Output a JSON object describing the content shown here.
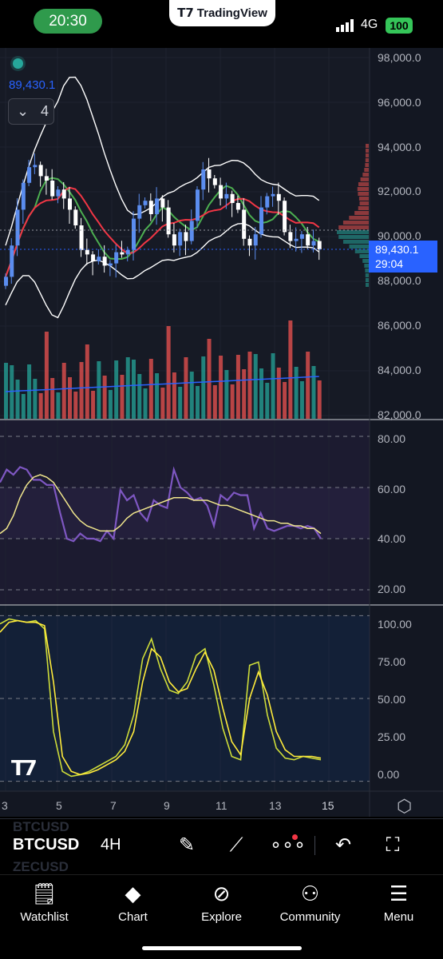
{
  "status_bar": {
    "time": "20:30",
    "app_brand": "TradingView",
    "network": "4G",
    "battery": "100"
  },
  "legend": {
    "price": "89,430.1",
    "collapse_count": "4"
  },
  "price_axis": {
    "labels": [
      "98,000.0",
      "96,000.0",
      "94,000.0",
      "92,000.0",
      "90,000.0",
      "88,000.0",
      "86,000.0",
      "84,000.0",
      "82,000.0"
    ],
    "current_price": "89,430.1",
    "countdown": "29:04"
  },
  "rsi_axis": {
    "labels": [
      "80.00",
      "60.00",
      "40.00",
      "20.00"
    ]
  },
  "stoch_axis": {
    "labels": [
      "100.00",
      "75.00",
      "50.00",
      "25.00",
      "0.00"
    ]
  },
  "time_axis": {
    "labels": [
      "3",
      "5",
      "7",
      "9",
      "11",
      "13",
      "15"
    ]
  },
  "toolbar": {
    "symbol": "BTCUSD",
    "interval": "4H",
    "ghost_symbols": [
      "BTCUSD",
      "ZECUSD"
    ]
  },
  "nav": {
    "items": [
      {
        "label": "Watchlist",
        "icon": "watchlist-icon"
      },
      {
        "label": "Chart",
        "icon": "chart-icon"
      },
      {
        "label": "Explore",
        "icon": "compass-icon"
      },
      {
        "label": "Community",
        "icon": "community-icon"
      },
      {
        "label": "Menu",
        "icon": "menu-icon"
      }
    ]
  },
  "colors": {
    "background": "#131722",
    "up": "#5b8def",
    "down": "#ffffff",
    "volume_up": "#26a69a",
    "volume_down": "#ef5350",
    "rsi": "#7e57c2",
    "rsi_ma": "#f0e68c",
    "stoch_k": "#cddc39",
    "stoch_d": "#ffeb3b",
    "accent": "#2962ff"
  },
  "chart_data": [
    {
      "type": "candlestick",
      "title": "",
      "symbol": "BTCUSD",
      "interval": "4H",
      "ylim": [
        82000,
        98000
      ],
      "x_ticks": [
        "3",
        "5",
        "7",
        "9",
        "11",
        "13",
        "15"
      ],
      "last_price": 89430.1,
      "close_series": [
        88200,
        89600,
        91200,
        92400,
        93100,
        93200,
        92700,
        92500,
        91800,
        92100,
        91700,
        91200,
        90500,
        89400,
        89200,
        88900,
        89100,
        88700,
        88800,
        89300,
        89200,
        89400,
        90800,
        91400,
        91600,
        91000,
        91700,
        91300,
        90100,
        89600,
        90200,
        89800,
        90700,
        92100,
        93000,
        92600,
        92300,
        91700,
        91900,
        91500,
        91200,
        89900,
        89600,
        90100,
        91300,
        91800,
        91900,
        91600,
        90200,
        89800,
        89900,
        90100,
        89600,
        89800,
        89430.1
      ],
      "bollinger_upper_range": [
        88000,
        97400
      ],
      "bollinger_lower_range": [
        83900,
        89200
      ]
    },
    {
      "type": "line",
      "title": "",
      "ylim": [
        15,
        85
      ],
      "series": [
        {
          "values": [
            62,
            67,
            65,
            68,
            67,
            63,
            63,
            61,
            61,
            50,
            40,
            39,
            42,
            40,
            40,
            39,
            43,
            40,
            59,
            55,
            57,
            50,
            47,
            55,
            53,
            52,
            67,
            60,
            58,
            55,
            56,
            53,
            45,
            57,
            55,
            58,
            57,
            57,
            44,
            50,
            44,
            43,
            44,
            45,
            45,
            44,
            45,
            44,
            40
          ]
        },
        {
          "values": [
            42,
            44,
            49,
            56,
            61,
            64,
            65,
            64,
            62,
            58,
            54,
            50,
            47,
            45,
            44,
            43,
            43,
            43,
            45,
            48,
            50,
            51,
            52,
            53,
            54,
            55,
            56,
            56,
            56,
            55,
            55,
            55,
            54,
            53,
            53,
            52,
            51,
            50,
            49,
            48,
            47,
            47,
            46,
            46,
            45,
            45,
            44,
            44,
            42
          ]
        }
      ]
    },
    {
      "type": "line",
      "title": "",
      "ylim": [
        -5,
        105
      ],
      "series": [
        {
          "values": [
            95,
            98,
            97,
            96,
            97,
            92,
            30,
            6,
            3,
            4,
            6,
            9,
            12,
            15,
            22,
            40,
            74,
            86,
            68,
            55,
            53,
            60,
            76,
            80,
            58,
            32,
            15,
            13,
            70,
            72,
            40,
            20,
            14,
            13,
            15,
            14,
            13
          ]
        },
        {
          "values": [
            90,
            96,
            97,
            96,
            96,
            94,
            60,
            15,
            6,
            4,
            5,
            7,
            10,
            13,
            18,
            30,
            60,
            80,
            75,
            60,
            54,
            56,
            68,
            78,
            67,
            44,
            24,
            16,
            50,
            66,
            52,
            30,
            19,
            15,
            15,
            15,
            14
          ]
        }
      ]
    }
  ]
}
